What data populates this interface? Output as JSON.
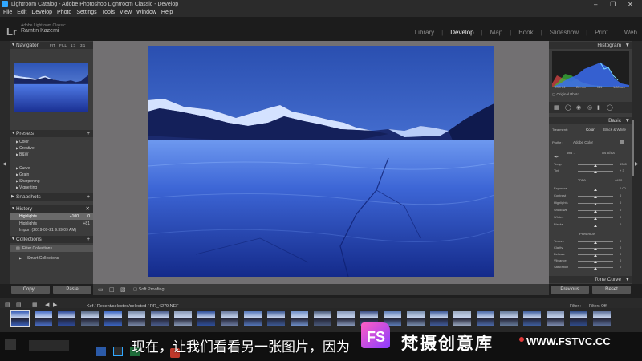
{
  "window": {
    "title": "Lightroom Catalog - Adobe Photoshop Lightroom Classic - Develop"
  },
  "menu": [
    "File",
    "Edit",
    "Develop",
    "Photo",
    "Settings",
    "Tools",
    "View",
    "Window",
    "Help"
  ],
  "identity": {
    "logo": "Lr",
    "line1": "Adobe Lightroom Classic",
    "line2": "Ramtin Kazemi"
  },
  "modules": [
    {
      "label": "Library"
    },
    {
      "label": "Develop"
    },
    {
      "label": "Map"
    },
    {
      "label": "Book"
    },
    {
      "label": "Slideshow"
    },
    {
      "label": "Print"
    },
    {
      "label": "Web"
    }
  ],
  "left": {
    "navigator": {
      "title": "Navigator",
      "zoom": [
        "FIT",
        "FILL",
        "1:1",
        "3:1"
      ]
    },
    "presets": {
      "title": "Presets",
      "items": [
        "Color",
        "Creative",
        "B&W",
        "Curve",
        "Grain",
        "Sharpening",
        "Vignetting"
      ]
    },
    "snapshots": {
      "title": "Snapshots"
    },
    "history": {
      "title": "History",
      "items": [
        {
          "label": "Highlights",
          "value": "+100"
        },
        {
          "label": "Highlights",
          "value": "+81"
        },
        {
          "label": "Import (2019-09-21 9:39:09 AM)",
          "value": ""
        }
      ]
    },
    "collections": {
      "title": "Collections",
      "items": [
        "Filter Collections",
        "Smart Collections"
      ]
    },
    "copy": "Copy...",
    "paste": "Paste"
  },
  "right": {
    "histogram": {
      "title": "Histogram",
      "readouts": [
        "ISO 64",
        "28 mm",
        "f/11",
        "1/60 sec"
      ],
      "original": "Original Photo"
    },
    "basic": {
      "title": "Basic",
      "treatment": "Treatment :",
      "color": "Color",
      "bw": "Black & White",
      "profile_label": "Profile :",
      "profile_value": "Adobe Color",
      "wb": "WB :",
      "wb_value": "As Shot",
      "sliders1": [
        {
          "label": "Temp",
          "value": "5300"
        },
        {
          "label": "Tint",
          "value": "+ 3"
        }
      ],
      "tone": "Tone",
      "auto": "Auto",
      "sliders2": [
        {
          "label": "Exposure",
          "value": "0.00"
        },
        {
          "label": "Contrast",
          "value": "0"
        },
        {
          "label": "Highlights",
          "value": "0"
        },
        {
          "label": "Shadows",
          "value": "0"
        },
        {
          "label": "Whites",
          "value": "0"
        },
        {
          "label": "Blacks",
          "value": "0"
        }
      ],
      "presence": "Presence",
      "sliders3": [
        {
          "label": "Texture",
          "value": "0"
        },
        {
          "label": "Clarity",
          "value": "0"
        },
        {
          "label": "Dehaze",
          "value": "0"
        },
        {
          "label": "Vibrance",
          "value": "0"
        },
        {
          "label": "Saturation",
          "value": "0"
        }
      ]
    },
    "tonecurve": {
      "title": "Tone Curve"
    },
    "previous": "Previous",
    "reset": "Reset"
  },
  "toolbar": {
    "soft_proofing": "Soft Proofing"
  },
  "filmstrip": {
    "path": "Kef  / Recent/selected/selected / RR_4279.NEF",
    "filter_label": "Filter :",
    "filter_value": "Filters Off"
  },
  "subtitle": "现在，让我们看看另一张图片，因为",
  "watermark": {
    "logo": "FS",
    "name": "梵摄创意库",
    "url": "WWW.FSTVC.CC"
  },
  "colors": {
    "bg": "#1f1f1f",
    "panel": "#3c3c3c",
    "center": "#727072",
    "accent": "#bf3fff"
  }
}
